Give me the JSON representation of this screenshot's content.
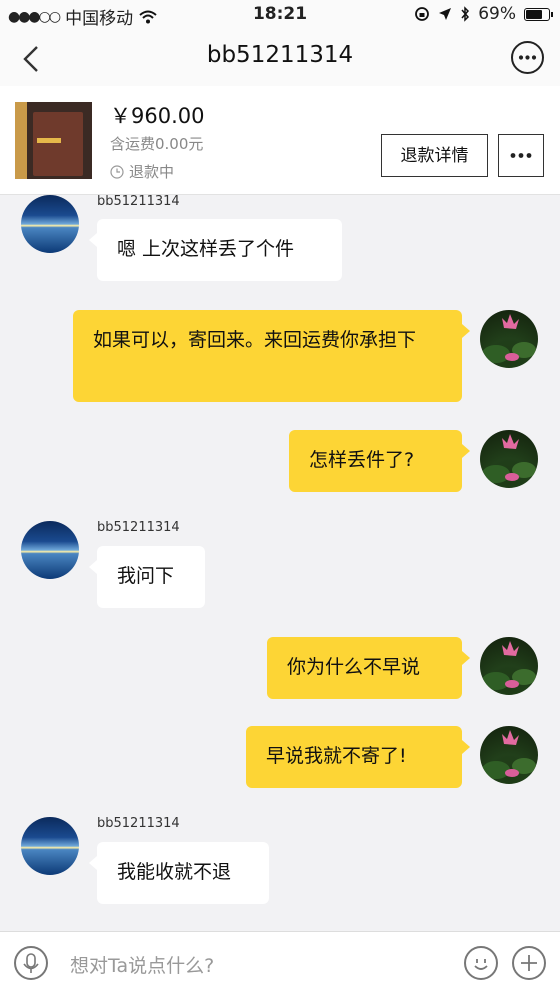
{
  "status_bar": {
    "carrier": "中国移动",
    "time": "18:21",
    "battery": "69%",
    "battery_level": 0.69,
    "icons": [
      "signal-dots-icon",
      "wifi-icon",
      "screen-lock-icon",
      "location-icon",
      "bluetooth-icon",
      "battery-icon"
    ]
  },
  "header": {
    "title": "bb51211314",
    "icons": [
      "back-chevron-icon",
      "more-circle-icon"
    ]
  },
  "order": {
    "price": "￥960.00",
    "shipping": "含运费0.00元",
    "status": "退款中",
    "refund_detail_button": "退款详情",
    "icons": [
      "clock-icon",
      "more-dots-icon"
    ]
  },
  "messages": [
    {
      "from": "other",
      "sender": "bb51211314",
      "text": "嗯 上次这样丢了个件"
    },
    {
      "from": "me",
      "text": "如果可以，寄回来。来回运费你承担下"
    },
    {
      "from": "me",
      "text": "怎样丢件了?"
    },
    {
      "from": "other",
      "sender": "bb51211314",
      "text": "我问下"
    },
    {
      "from": "me",
      "text": "你为什么不早说"
    },
    {
      "from": "me",
      "text": "早说我就不寄了!"
    },
    {
      "from": "other",
      "sender": "bb51211314",
      "text": "我能收就不退"
    }
  ],
  "input_bar": {
    "placeholder": "想对Ta说点什么?",
    "icons": [
      "microphone-icon",
      "emoji-icon",
      "plus-icon"
    ]
  },
  "colors": {
    "outgoing_bubble": "#fdd535",
    "incoming_bubble": "#ffffff",
    "background": "#f2f2f4"
  }
}
